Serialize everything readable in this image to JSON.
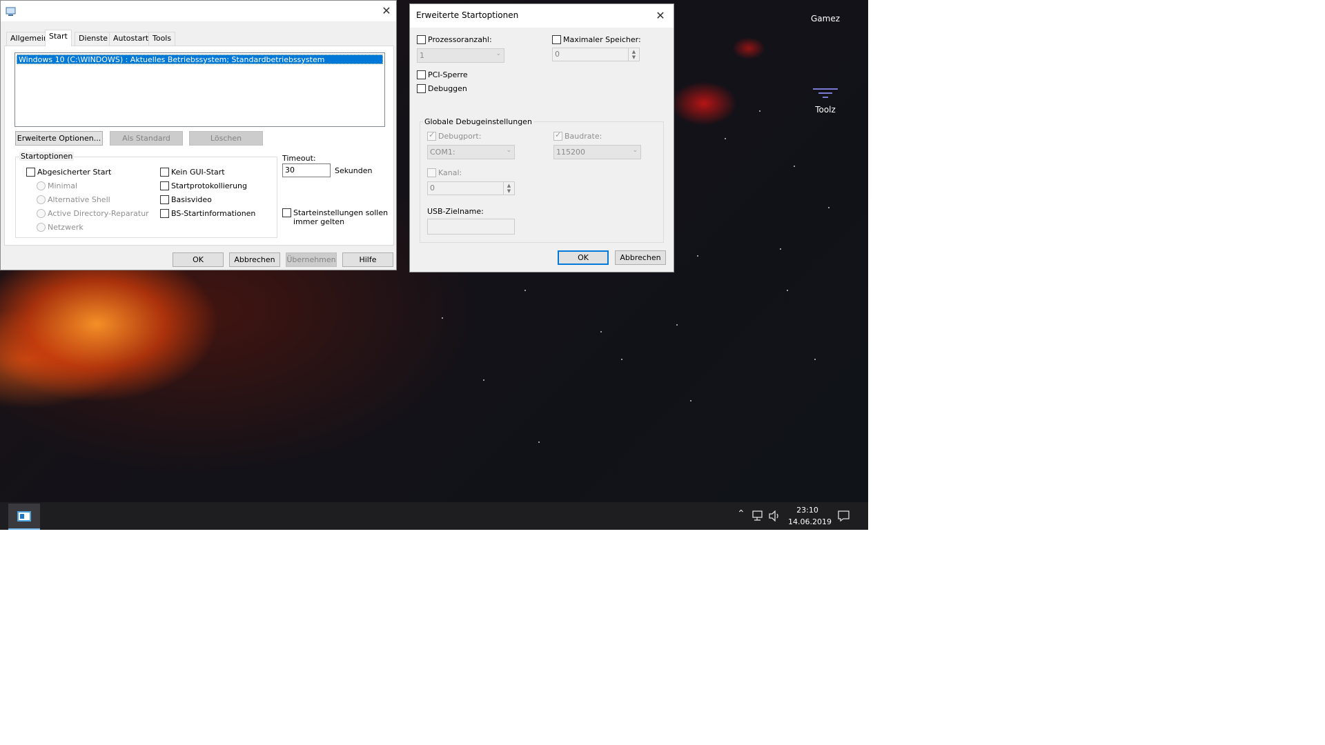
{
  "desktop": {
    "icons": [
      {
        "label": "Gamez"
      },
      {
        "label": "Toolz"
      }
    ]
  },
  "taskbar": {
    "time": "23:10",
    "date": "14.06.2019"
  },
  "msconfig": {
    "tabs": [
      {
        "label": "Allgemein"
      },
      {
        "label": "Start"
      },
      {
        "label": "Dienste"
      },
      {
        "label": "Autostart"
      },
      {
        "label": "Tools"
      }
    ],
    "os_entry": "Windows 10 (C:\\WINDOWS) : Aktuelles Betriebssystem; Standardbetriebssystem",
    "buttons": {
      "advanced": "Erweiterte Optionen...",
      "set_default": "Als Standard",
      "delete": "Löschen",
      "ok": "OK",
      "cancel": "Abbrechen",
      "apply": "Übernehmen",
      "help": "Hilfe"
    },
    "boot_options_title": "Startoptionen",
    "safe_boot": "Abgesicherter Start",
    "safe_boot_modes": [
      "Minimal",
      "Alternative Shell",
      "Active Directory-Reparatur",
      "Netzwerk"
    ],
    "no_gui": "Kein GUI-Start",
    "boot_log": "Startprotokollierung",
    "base_video": "Basisvideo",
    "os_boot_info": "BS-Startinformationen",
    "timeout_label": "Timeout:",
    "timeout_value": "30",
    "timeout_unit": "Sekunden",
    "permanent_line1": "Starteinstellungen sollen",
    "permanent_line2": "immer gelten"
  },
  "advanced": {
    "title": "Erweiterte Startoptionen",
    "num_procs": "Prozessoranzahl:",
    "num_procs_value": "1",
    "max_mem": "Maximaler Speicher:",
    "max_mem_value": "0",
    "pci_lock": "PCI-Sperre",
    "debug": "Debuggen",
    "global_debug_title": "Globale Debugeinstellungen",
    "debug_port": "Debugport:",
    "debug_port_value": "COM1:",
    "baud_rate": "Baudrate:",
    "baud_rate_value": "115200",
    "channel": "Kanal:",
    "channel_value": "0",
    "usb_target": "USB-Zielname:",
    "ok": "OK",
    "cancel": "Abbrechen"
  }
}
